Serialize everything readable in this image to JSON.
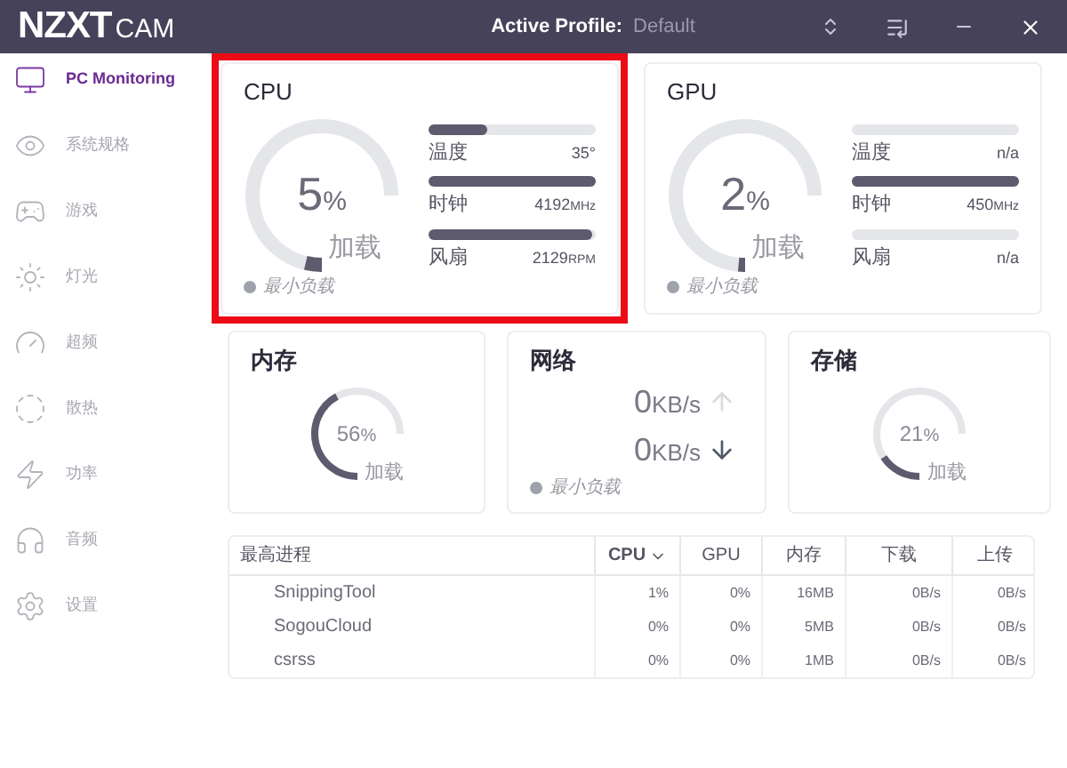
{
  "titlebar": {
    "logo": "NZXT",
    "app": "CAM",
    "profile_label": "Active Profile:",
    "profile_value": "Default"
  },
  "sidebar": {
    "items": [
      {
        "label": "PC Monitoring",
        "selected": true
      },
      {
        "label": "系统规格",
        "selected": false
      },
      {
        "label": "游戏",
        "selected": false
      },
      {
        "label": "灯光",
        "selected": false
      },
      {
        "label": "超频",
        "selected": false
      },
      {
        "label": "散热",
        "selected": false
      },
      {
        "label": "功率",
        "selected": false
      },
      {
        "label": "音频",
        "selected": false
      },
      {
        "label": "设置",
        "selected": false
      }
    ]
  },
  "cpu": {
    "title": "CPU",
    "highlighted": true,
    "gauge": {
      "value": "5",
      "unit": "%",
      "caption": "加载"
    },
    "legend": "最小负载",
    "meters": [
      {
        "label": "温度",
        "reading": "35°",
        "level": 0.35
      },
      {
        "label": "时钟",
        "reading": "4192",
        "unit": "MHz",
        "level": 1
      },
      {
        "label": "风扇",
        "reading": "2129",
        "unit": "RPM",
        "level": 0.98
      }
    ]
  },
  "gpu": {
    "title": "GPU",
    "highlighted": false,
    "gauge": {
      "value": "2",
      "unit": "%",
      "caption": "加载"
    },
    "legend": "最小负载",
    "meters": [
      {
        "label": "温度",
        "reading": "n/a",
        "level": 0
      },
      {
        "label": "时钟",
        "reading": "450",
        "unit": "MHz",
        "level": 1
      },
      {
        "label": "风扇",
        "reading": "n/a",
        "level": 0
      }
    ]
  },
  "memory": {
    "title": "内存",
    "gauge": {
      "value": "56",
      "unit": "%",
      "caption": "加载"
    }
  },
  "network": {
    "title": "网络",
    "rates": [
      {
        "kind": "up",
        "value": "0",
        "unit": "KB/s"
      },
      {
        "kind": "down",
        "value": "0",
        "unit": "KB/s"
      }
    ],
    "legend": "最小负载"
  },
  "storage": {
    "title": "存储",
    "gauge": {
      "value": "21",
      "unit": "%",
      "caption": "加载"
    }
  },
  "table": {
    "columns": [
      {
        "label": "最高进程",
        "sorted": false
      },
      {
        "label": "CPU",
        "sorted": true
      },
      {
        "label": "GPU",
        "sorted": false
      },
      {
        "label": "内存",
        "sorted": false
      },
      {
        "label": "下载",
        "sorted": false
      },
      {
        "label": "上传",
        "sorted": false
      }
    ],
    "rows": [
      [
        "SnippingTool",
        "1%",
        "0%",
        "16MB",
        "0B/s",
        "0B/s"
      ],
      [
        "SogouCloud",
        "0%",
        "0%",
        "5MB",
        "0B/s",
        "0B/s"
      ],
      [
        "csrss",
        "0%",
        "0%",
        "1MB",
        "0B/s",
        "0B/s"
      ]
    ]
  }
}
